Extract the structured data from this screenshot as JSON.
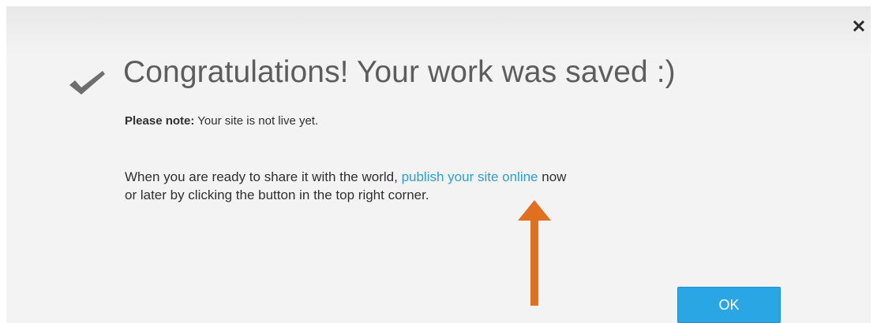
{
  "dialog": {
    "title": "Congratulations! Your work was saved :)",
    "note_label": "Please note:",
    "note_text": " Your site is not live yet.",
    "message_before_link": "When you are ready to share it with the world, ",
    "link_text": "publish your site online",
    "message_after_link": " now",
    "message_line2": "or later by clicking the button in the top right corner.",
    "ok_label": "OK",
    "close_label": "×"
  },
  "colors": {
    "link": "#2a9fd8",
    "ok_button": "#2aa6e4",
    "arrow": "#e07020",
    "checkmark": "#6e6e6e"
  },
  "icons": {
    "checkmark": "check-icon",
    "close": "close-icon",
    "annotation": "arrow-up-icon"
  }
}
